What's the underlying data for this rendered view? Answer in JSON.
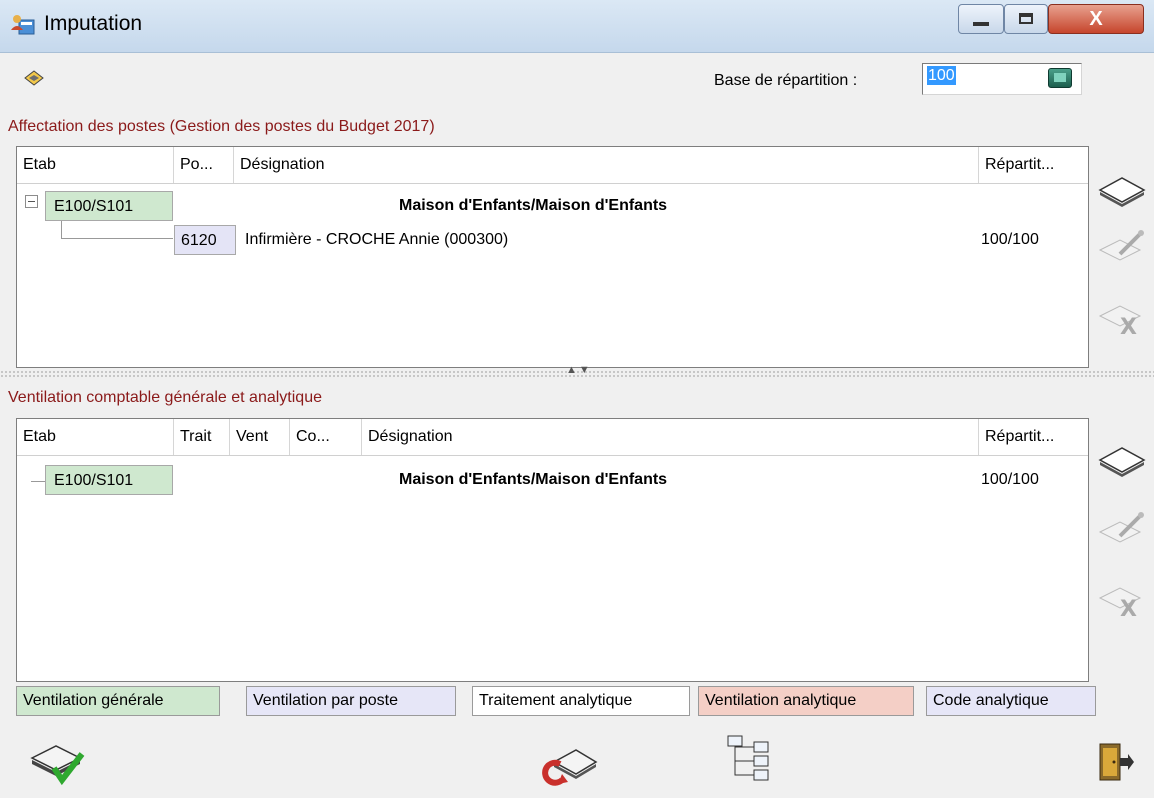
{
  "window": {
    "title": "Imputation"
  },
  "base_repartition": {
    "label": "Base de répartition :",
    "value": "100"
  },
  "affectation": {
    "title": "Affectation des postes (Gestion des postes du Budget 2017)",
    "columns": [
      "Etab",
      "Po...",
      "Désignation",
      "Répartit..."
    ],
    "rows": [
      {
        "etab": "E100/S101",
        "designation": "Maison d'Enfants/Maison d'Enfants"
      },
      {
        "poste": "6120",
        "designation": "Infirmière - CROCHE Annie (000300)",
        "repartition": "100/100"
      }
    ]
  },
  "ventilation": {
    "title": "Ventilation comptable générale et analytique",
    "columns": [
      "Etab",
      "Trait",
      "Vent",
      "Co...",
      "Désignation",
      "Répartit..."
    ],
    "rows": [
      {
        "etab": "E100/S101",
        "designation": "Maison d'Enfants/Maison d'Enfants",
        "repartition": "100/100"
      }
    ]
  },
  "legend": [
    {
      "label": "Ventilation générale",
      "color": "#cfe8cf"
    },
    {
      "label": "Ventilation par poste",
      "color": "#e6e6f7"
    },
    {
      "label": "Traitement analytique",
      "color": "#ffffff"
    },
    {
      "label": "Ventilation analytique",
      "color": "#f4cfc6"
    },
    {
      "label": "Code analytique",
      "color": "#e6e6f7"
    }
  ],
  "icons": {
    "side_actions": [
      "add-icon",
      "edit-icon",
      "delete-icon"
    ],
    "bottom_actions": [
      "validate-icon",
      "refresh-icon",
      "tree-icon",
      "exit-icon"
    ]
  }
}
